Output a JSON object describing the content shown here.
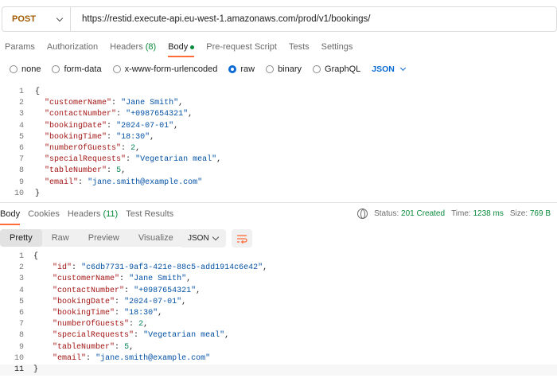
{
  "request": {
    "method": "POST",
    "url": "https://restid.execute-api.eu-west-1.amazonaws.com/prod/v1/bookings/"
  },
  "request_tabs": [
    {
      "label": "Params"
    },
    {
      "label": "Authorization"
    },
    {
      "label": "Headers",
      "count": "(8)"
    },
    {
      "label": "Body"
    },
    {
      "label": "Pre-request Script"
    },
    {
      "label": "Tests"
    },
    {
      "label": "Settings"
    }
  ],
  "body_types": [
    "none",
    "form-data",
    "x-www-form-urlencoded",
    "raw",
    "binary",
    "GraphQL"
  ],
  "body_format": "JSON",
  "request_body_lines": [
    {
      "n": "1",
      "t": "{"
    },
    {
      "n": "2",
      "t": "  \"customerName\": \"Jane Smith\","
    },
    {
      "n": "3",
      "t": "  \"contactNumber\": \"+0987654321\","
    },
    {
      "n": "4",
      "t": "  \"bookingDate\": \"2024-07-01\","
    },
    {
      "n": "5",
      "t": "  \"bookingTime\": \"18:30\","
    },
    {
      "n": "6",
      "t": "  \"numberOfGuests\": 2,"
    },
    {
      "n": "7",
      "t": "  \"specialRequests\": \"Vegetarian meal\","
    },
    {
      "n": "8",
      "t": "  \"tableNumber\": 5,"
    },
    {
      "n": "9",
      "t": "  \"email\": \"jane.smith@example.com\""
    },
    {
      "n": "10",
      "t": "}"
    }
  ],
  "response_tabs": [
    {
      "label": "Body"
    },
    {
      "label": "Cookies"
    },
    {
      "label": "Headers",
      "count": "(11)"
    },
    {
      "label": "Test Results"
    }
  ],
  "response_status": {
    "status_label": "Status:",
    "status_value": "201 Created",
    "time_label": "Time:",
    "time_value": "1238 ms",
    "size_label": "Size:",
    "size_value": "769 B"
  },
  "response_views": [
    "Pretty",
    "Raw",
    "Preview",
    "Visualize"
  ],
  "response_format": "JSON",
  "response_body_lines": [
    {
      "n": "1",
      "t": "{"
    },
    {
      "n": "2",
      "t": "    \"id\": \"c6db7731-9af3-421e-88c5-add1914c6e42\","
    },
    {
      "n": "3",
      "t": "    \"customerName\": \"Jane Smith\","
    },
    {
      "n": "4",
      "t": "    \"contactNumber\": \"+0987654321\","
    },
    {
      "n": "5",
      "t": "    \"bookingDate\": \"2024-07-01\","
    },
    {
      "n": "6",
      "t": "    \"bookingTime\": \"18:30\","
    },
    {
      "n": "7",
      "t": "    \"numberOfGuests\": 2,"
    },
    {
      "n": "8",
      "t": "    \"specialRequests\": \"Vegetarian meal\","
    },
    {
      "n": "9",
      "t": "    \"tableNumber\": 5,"
    },
    {
      "n": "10",
      "t": "    \"email\": \"jane.smith@example.com\""
    },
    {
      "n": "11",
      "t": "}"
    }
  ],
  "colors": {
    "accent": "#ff6c37",
    "success": "#0a8a3a",
    "link": "#0b6bd3",
    "method": "#a05a00"
  }
}
